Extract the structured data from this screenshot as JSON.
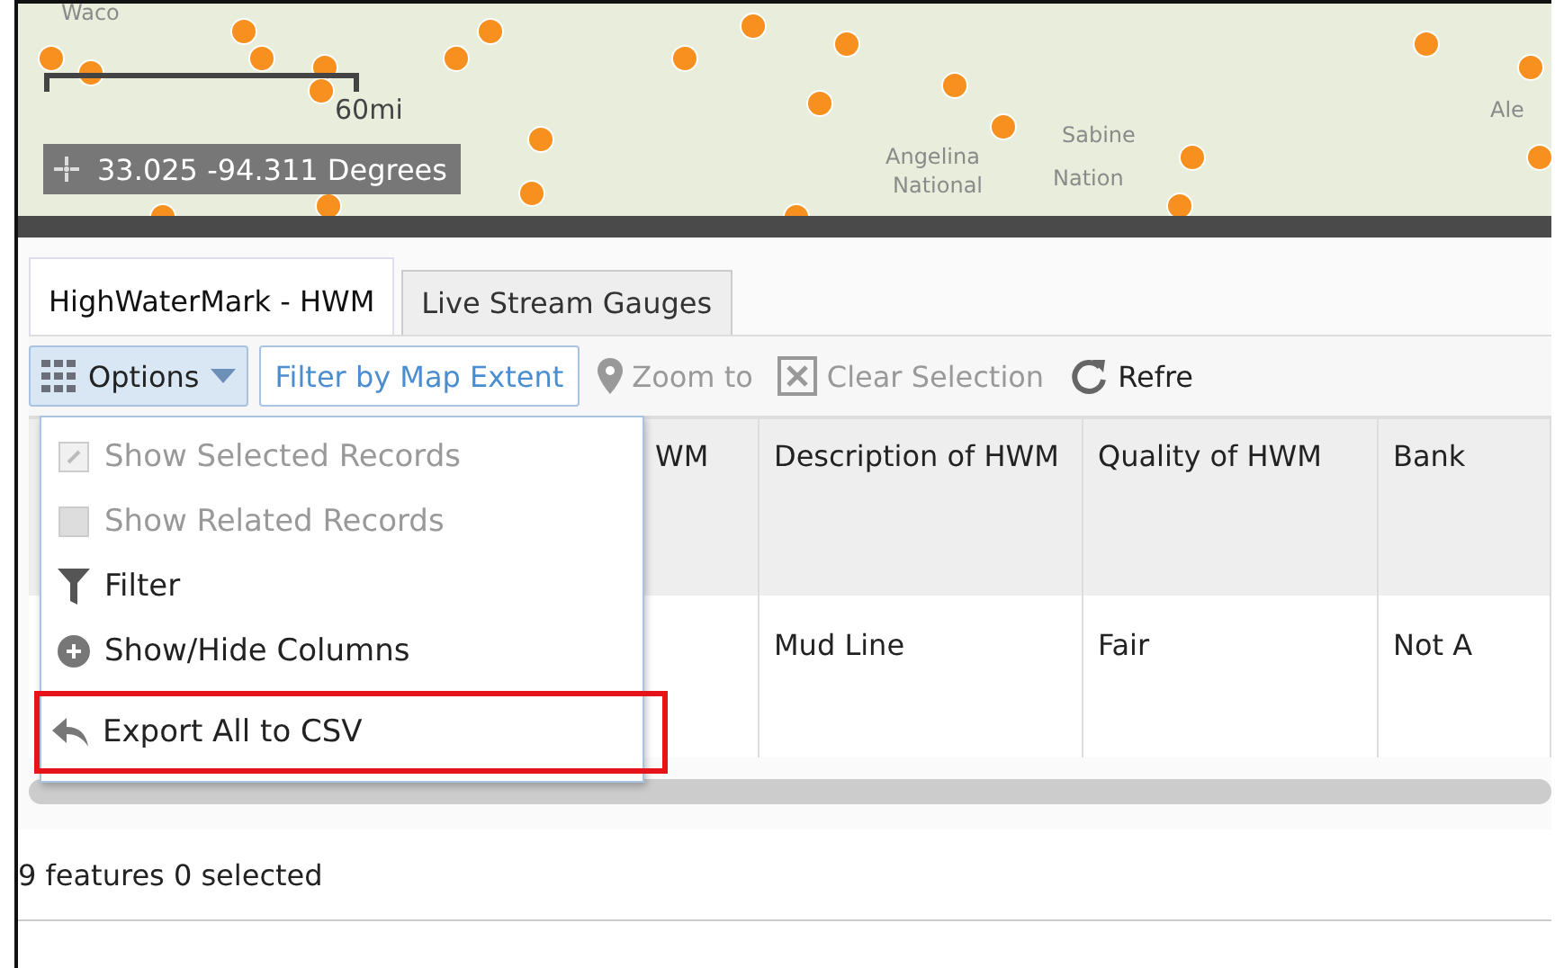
{
  "map": {
    "labels": [
      {
        "text": "Waco"
      },
      {
        "text": "Angelina"
      },
      {
        "text": "National"
      },
      {
        "text": "Sabine"
      },
      {
        "text": "Nation"
      },
      {
        "text": "Ale"
      }
    ],
    "scale": "60mi",
    "coordinates": "33.025 -94.311 Degrees"
  },
  "tabs": [
    {
      "label": "HighWaterMark - HWM",
      "selected": true
    },
    {
      "label": "Live Stream Gauges",
      "selected": false
    }
  ],
  "toolbar": {
    "options": "Options",
    "filter": "Filter by Map Extent",
    "actions": [
      {
        "label": "Zoom to",
        "kind": "pin",
        "disabled": true
      },
      {
        "label": "Clear Selection",
        "kind": "clear",
        "disabled": true
      },
      {
        "label": "Refre",
        "kind": "refresh",
        "disabled": false
      }
    ]
  },
  "menu": [
    {
      "label": "Show Selected Records",
      "kind": "selected",
      "disabled": true,
      "highlighted": false
    },
    {
      "label": "Show Related Records",
      "kind": "related",
      "disabled": true,
      "highlighted": false
    },
    {
      "label": "Filter",
      "kind": "filter",
      "disabled": false,
      "highlighted": false
    },
    {
      "label": "Show/Hide Columns",
      "kind": "columns",
      "disabled": false,
      "highlighted": false
    },
    {
      "label": "Export All to CSV",
      "kind": "export",
      "disabled": false,
      "highlighted": true
    }
  ],
  "table": {
    "columns": [
      "WM",
      "Description of HWM",
      "Quality of HWM",
      "Bank"
    ],
    "rows": [
      {
        "cells": [
          "",
          "Mud Line",
          "Fair",
          "Not A"
        ]
      }
    ]
  },
  "status": "9 features 0 selected"
}
